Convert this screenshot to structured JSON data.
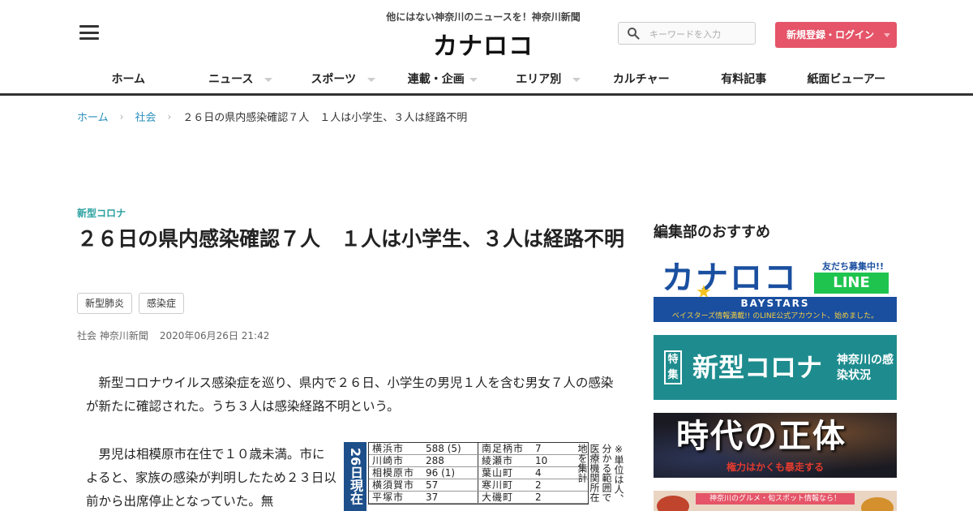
{
  "header": {
    "tagline": "他にはない神奈川のニュースを！神奈川新聞",
    "logo": "カナロコ",
    "search_placeholder": "キーワードを入力",
    "login_label": "新規登録・ログイン",
    "nav": [
      {
        "label": "ホーム",
        "dropdown": false
      },
      {
        "label": "ニュース",
        "dropdown": true
      },
      {
        "label": "スポーツ",
        "dropdown": true
      },
      {
        "label": "連載・企画",
        "dropdown": true
      },
      {
        "label": "エリア別",
        "dropdown": true
      },
      {
        "label": "カルチャー",
        "dropdown": false
      },
      {
        "label": "有料記事",
        "dropdown": false
      },
      {
        "label": "紙面ビューアー",
        "dropdown": false
      }
    ]
  },
  "breadcrumb": {
    "home": "ホーム",
    "section": "社会",
    "current": "２６日の県内感染確認７人　１人は小学生、３人は経路不明"
  },
  "article": {
    "category": "新型コロナ",
    "title": "２６日の県内感染確認７人　１人は小学生、３人は経路不明",
    "tags": [
      "新型肺炎",
      "感染症"
    ],
    "section": "社会",
    "source": "神奈川新聞",
    "datetime": "2020年06月26日 21:42",
    "paragraph1": "新型コロナウイルス感染症を巡り、県内で２６日、小学生の男児１人を含む男女７人の感染が新たに確認された。うち３人は感染経路不明という。",
    "paragraph2": "男児は相模原市在住で１０歳未満。市によると、家族の感染が判明したため２３日以前から出席停止となっていた。無"
  },
  "case_table": {
    "date_label": "26日現在",
    "rows": [
      {
        "city_l": "横浜市",
        "val_l": "588 (5)",
        "city_r": "南足柄市",
        "val_r": "7"
      },
      {
        "city_l": "川崎市",
        "val_l": "288",
        "city_r": "綾瀬市",
        "val_r": "10"
      },
      {
        "city_l": "相模原市",
        "val_l": "96 (1)",
        "city_r": "葉山町",
        "val_r": "4"
      },
      {
        "city_l": "横須賀市",
        "val_l": "57",
        "city_r": "寒川町",
        "val_r": "2"
      },
      {
        "city_l": "平塚市",
        "val_l": "37",
        "city_r": "大磯町",
        "val_r": "2"
      }
    ],
    "note": "※単位は人、分かる範囲で医療機関所在地を集計"
  },
  "sidebar": {
    "heading": "編集部のおすすめ",
    "banner_line": {
      "logo": "カナロコ",
      "friends": "友だち募集中!!",
      "line": "LINE",
      "baystars": "BAYSTARS",
      "info": "ベイスターズ情報満載!! のLINE公式アカウント、始めました。"
    },
    "banner_corona": {
      "badge": "特集",
      "main": "新型コロナ",
      "sub": "神奈川の感染状況"
    },
    "banner_era": {
      "main": "時代の正体",
      "sub": "権力はかくも暴走する"
    },
    "banner_gourmet": {
      "strip": "神奈川のグルメ・旬スポット情報なら！"
    }
  },
  "colors": {
    "accent": "#e55468",
    "link": "#2a8fbd",
    "category": "#2aa0a0",
    "corona_banner": "#1e8c8e"
  }
}
